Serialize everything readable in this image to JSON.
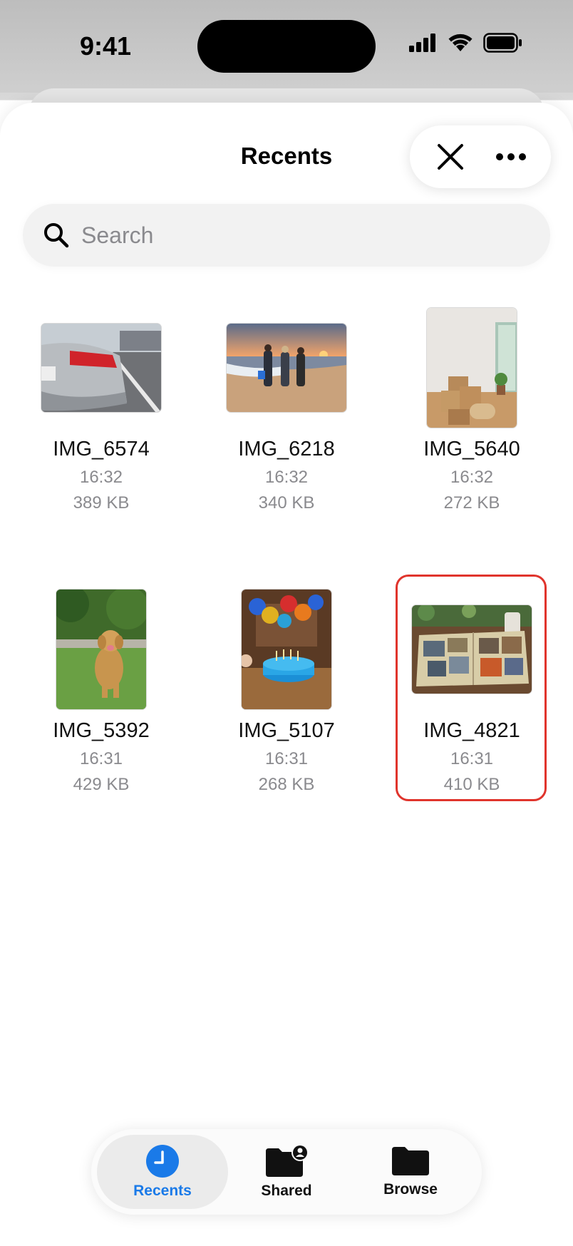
{
  "status_bar": {
    "time": "9:41"
  },
  "header": {
    "title": "Recents"
  },
  "search": {
    "placeholder": "Search"
  },
  "files": [
    {
      "name": "IMG_6574",
      "time": "16:32",
      "size": "389 KB"
    },
    {
      "name": "IMG_6218",
      "time": "16:32",
      "size": "340 KB"
    },
    {
      "name": "IMG_5640",
      "time": "16:32",
      "size": "272 KB"
    },
    {
      "name": "IMG_5392",
      "time": "16:31",
      "size": "429 KB"
    },
    {
      "name": "IMG_5107",
      "time": "16:31",
      "size": "268 KB"
    },
    {
      "name": "IMG_4821",
      "time": "16:31",
      "size": "410 KB"
    }
  ],
  "tabs": [
    {
      "label": "Recents",
      "icon": "clock-icon",
      "active": true
    },
    {
      "label": "Shared",
      "icon": "shared-folder-icon"
    },
    {
      "label": "Browse",
      "icon": "folder-icon"
    }
  ],
  "colors": {
    "accent": "#1a7ae8",
    "highlight": "#e0342c"
  }
}
